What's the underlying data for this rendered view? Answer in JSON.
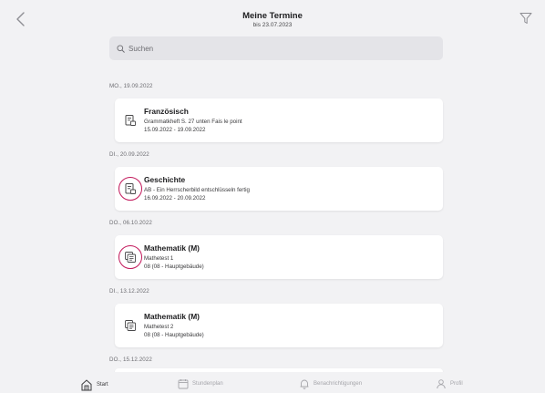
{
  "header": {
    "title": "Meine Termine",
    "subtitle": "bis 23.07.2023",
    "back_icon": "chevron-left-icon",
    "filter_icon": "filter-icon"
  },
  "search": {
    "placeholder": "Suchen",
    "icon": "search-icon"
  },
  "days": [
    {
      "label": "MO., 19.09.2022",
      "card": {
        "subject": "Französisch",
        "desc": "Grammatkheft S. 27 unten Fais le point",
        "dates": "15.09.2022 - 19.09.2022",
        "icon": "homework-icon",
        "highlighted": false
      }
    },
    {
      "label": "DI., 20.09.2022",
      "card": {
        "subject": "Geschichte",
        "desc": "AB - Ein Herrscherbild entschlüsseln fertig",
        "dates": "16.09.2022 - 20.09.2022",
        "icon": "homework-icon",
        "highlighted": true
      }
    },
    {
      "label": "DO., 06.10.2022",
      "card": {
        "subject": "Mathematik (M)",
        "desc": "Mathetest 1",
        "dates": "08 (08 - Hauptgebäude)",
        "icon": "test-icon",
        "highlighted": true
      }
    },
    {
      "label": "DI., 13.12.2022",
      "card": {
        "subject": "Mathematik (M)",
        "desc": "Mathetest 2",
        "dates": "08 (08 - Hauptgebäude)",
        "icon": "test-icon",
        "highlighted": false
      }
    },
    {
      "label": "DO., 15.12.2022",
      "card": null
    }
  ],
  "tabs": [
    {
      "label": "Start",
      "icon": "home-icon",
      "active": true
    },
    {
      "label": "Stundenplan",
      "icon": "calendar-icon",
      "active": false
    },
    {
      "label": "Benachrichtigungen",
      "icon": "bell-icon",
      "active": false
    },
    {
      "label": "Profil",
      "icon": "person-icon",
      "active": false
    }
  ],
  "colors": {
    "highlight": "#c2185b",
    "background": "#f2f2f4",
    "card": "#ffffff"
  }
}
